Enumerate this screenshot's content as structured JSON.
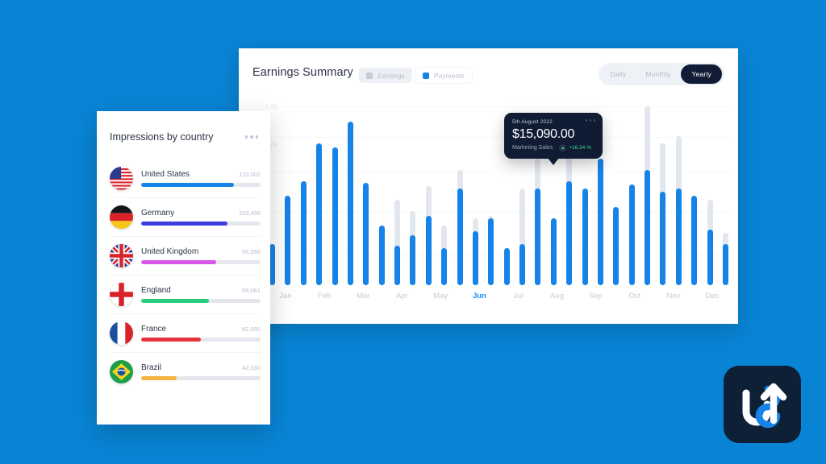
{
  "theme": {
    "background": "#0984d4",
    "accent": "#1683e8",
    "dark": "#101c36",
    "positive": "#3ddc97"
  },
  "chart_card": {
    "title": "Earnings Summary",
    "legend": [
      {
        "label": "Earnings",
        "color": "#c6ccd6",
        "active": false
      },
      {
        "label": "Payments",
        "color": "#1683e8",
        "active": true
      }
    ],
    "range_options": [
      {
        "label": "Daily",
        "active": false
      },
      {
        "label": "Monthly",
        "active": false
      },
      {
        "label": "Yearly",
        "active": true
      }
    ],
    "menu_icon": "ellipsis-icon"
  },
  "tooltip": {
    "date": "5th August 2022",
    "amount": "$15,090.00",
    "label": "Marketing Sales",
    "badge_icon": "trend-up-icon",
    "badge_text": "+16.24 %",
    "menu_icon": "ellipsis-icon"
  },
  "chart_data": {
    "type": "bar",
    "title": "Earnings Summary",
    "xlabel": "",
    "ylabel": "",
    "grid": true,
    "legend_position": "top-left",
    "categories": [
      "Jan",
      "Feb",
      "Mar",
      "Apr",
      "May",
      "Jun",
      "Jul",
      "Aug",
      "Sep",
      "Oct",
      "Nov",
      "Dec"
    ],
    "active_category": "Jun",
    "yticks": [
      "4.0k",
      "3.0k"
    ],
    "series": [
      {
        "name": "Earnings",
        "color": "#e2e7ee",
        "values": [
          22,
          48,
          56,
          76,
          74,
          88,
          55,
          32,
          46,
          40,
          53,
          32,
          62,
          36,
          37,
          20,
          52,
          68,
          36,
          82,
          52,
          68,
          42,
          54,
          96,
          76,
          80,
          48,
          46,
          28
        ]
      },
      {
        "name": "Payments",
        "color": "#1683e8",
        "values": [
          22,
          48,
          56,
          76,
          74,
          88,
          55,
          32,
          21,
          27,
          37,
          20,
          52,
          29,
          36,
          20,
          22,
          52,
          36,
          56,
          52,
          68,
          42,
          54,
          62,
          50,
          52,
          48,
          30,
          22
        ]
      }
    ]
  },
  "country_card": {
    "title": "Impressions by country",
    "menu_icon": "ellipsis-icon",
    "rows": [
      {
        "name": "United States",
        "value": "110,002",
        "percent": 78,
        "color": "#1683e8",
        "flag": "us-flag-icon"
      },
      {
        "name": "Germany",
        "value": "103,499",
        "percent": 72,
        "color": "#3c3ce0",
        "flag": "de-flag-icon"
      },
      {
        "name": "United Kingdom",
        "value": "96,998",
        "percent": 63,
        "color": "#d957e8",
        "flag": "gb-flag-icon"
      },
      {
        "name": "England",
        "value": "89,061",
        "percent": 57,
        "color": "#29cc7a",
        "flag": "en-flag-icon"
      },
      {
        "name": "France",
        "value": "82,000",
        "percent": 50,
        "color": "#e8323c",
        "flag": "fr-flag-icon"
      },
      {
        "name": "Brazil",
        "value": "42,030",
        "percent": 30,
        "color": "#f5b341",
        "flag": "br-flag-icon"
      }
    ]
  },
  "logo": {
    "name": "brand-logo"
  }
}
